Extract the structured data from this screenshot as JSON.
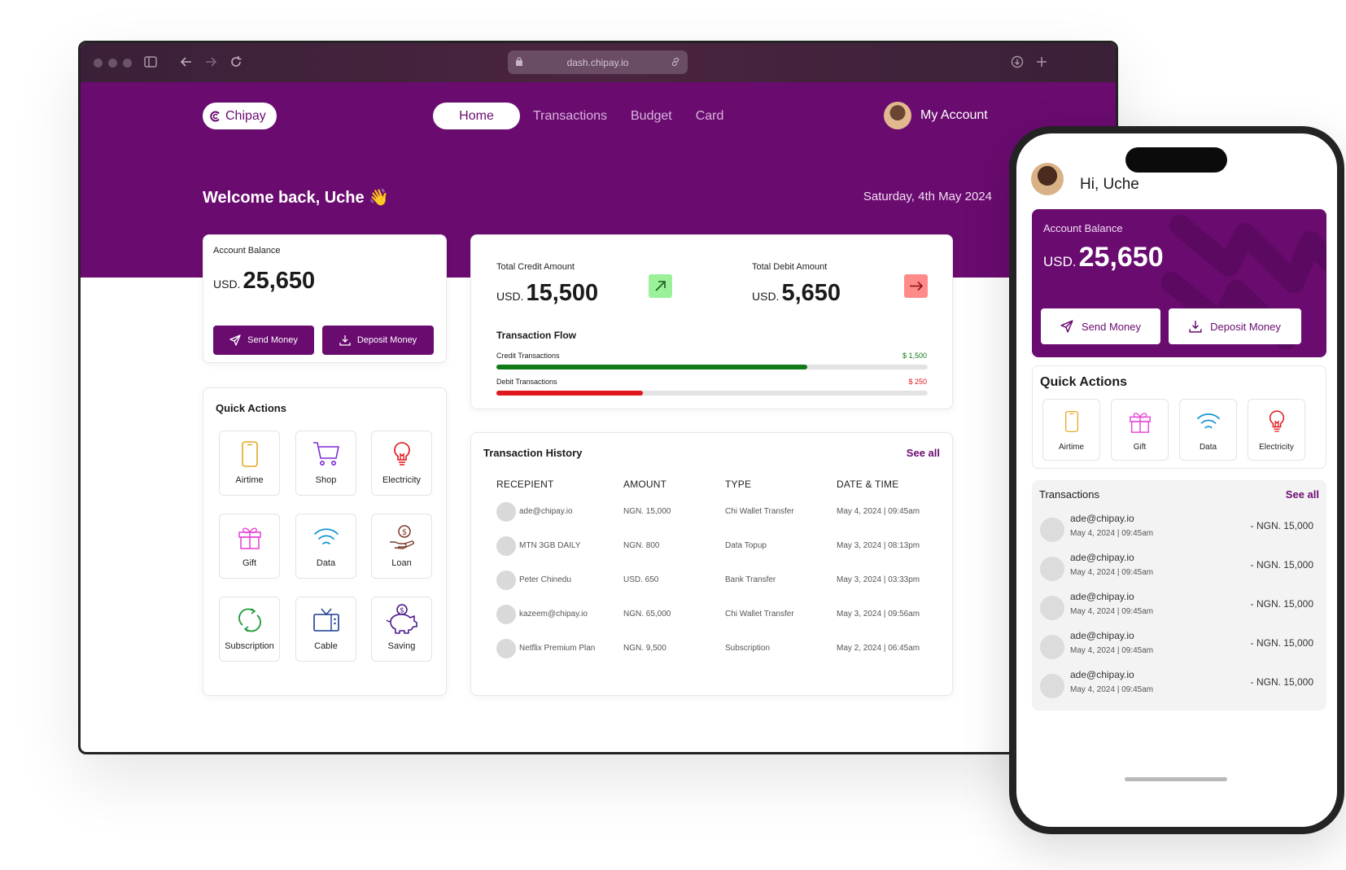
{
  "browser": {
    "url": "dash.chipay.io"
  },
  "nav": {
    "brand": "Chipay",
    "items": [
      "Home",
      "Transactions",
      "Budget",
      "Card"
    ],
    "account_label": "My Account"
  },
  "header": {
    "welcome": "Welcome back, Uche 👋",
    "date": "Saturday, 4th May 2024"
  },
  "balance": {
    "label": "Account Balance",
    "currency": "USD.",
    "amount": "25,650",
    "send_label": "Send Money",
    "deposit_label": "Deposit Money"
  },
  "summary": {
    "credit_label": "Total Credit Amount",
    "credit_currency": "USD.",
    "credit_amount": "15,500",
    "debit_label": "Total Debit Amount",
    "debit_currency": "USD.",
    "debit_amount": "5,650"
  },
  "flow": {
    "title": "Transaction Flow",
    "credit_label": "Credit Transactions",
    "credit_value": "$ 1,500",
    "credit_fraction": 0.72,
    "debit_label": "Debit Transactions",
    "debit_value": "$ 250",
    "debit_fraction": 0.34,
    "credit_color": "#0f7a16",
    "debit_color": "#e0161d"
  },
  "quick_actions": {
    "title": "Quick Actions",
    "items": [
      "Airtime",
      "Shop",
      "Electricity",
      "Gift",
      "Data",
      "Loan",
      "Subscription",
      "Cable",
      "Saving"
    ]
  },
  "history": {
    "title": "Transaction History",
    "see_all": "See all",
    "columns": [
      "RECEPIENT",
      "AMOUNT",
      "TYPE",
      "DATE & TIME"
    ],
    "rows": [
      [
        "ade@chipay.io",
        "NGN. 15,000",
        "Chi Wallet Transfer",
        "May 4, 2024 | 09:45am"
      ],
      [
        "MTN 3GB DAILY",
        "NGN. 800",
        "Data Topup",
        "May 3, 2024 | 08:13pm"
      ],
      [
        "Peter Chinedu",
        "USD. 650",
        "Bank Transfer",
        "May 3, 2024 | 03:33pm"
      ],
      [
        "kazeem@chipay.io",
        "NGN. 65,000",
        "Chi Wallet Transfer",
        "May 3, 2024 | 09:56am"
      ],
      [
        "Netflix Premium Plan",
        "NGN. 9,500",
        "Subscription",
        "May 2, 2024 | 06:45am"
      ]
    ]
  },
  "mobile": {
    "greeting": "Hi, Uche",
    "balance_label": "Account Balance",
    "currency": "USD.",
    "amount": "25,650",
    "send_label": "Send Money",
    "deposit_label": "Deposit Money",
    "quick_title": "Quick Actions",
    "quick_items": [
      "Airtime",
      "Gift",
      "Data",
      "Electricity"
    ],
    "tx_title": "Transactions",
    "see_all": "See all",
    "tx_rows": [
      {
        "who": "ade@chipay.io",
        "when": "May 4, 2024 | 09:45am",
        "amount": "- NGN. 15,000"
      },
      {
        "who": "ade@chipay.io",
        "when": "May 4, 2024 | 09:45am",
        "amount": "- NGN. 15,000"
      },
      {
        "who": "ade@chipay.io",
        "when": "May 4, 2024 | 09:45am",
        "amount": "- NGN. 15,000"
      },
      {
        "who": "ade@chipay.io",
        "when": "May 4, 2024 | 09:45am",
        "amount": "- NGN. 15,000"
      },
      {
        "who": "ade@chipay.io",
        "when": "May 4, 2024 | 09:45am",
        "amount": "- NGN. 15,000"
      }
    ]
  },
  "colors": {
    "brand": "#6a0b70",
    "credit_badge": "#9af19a",
    "debit_badge": "#ff8a8a"
  }
}
